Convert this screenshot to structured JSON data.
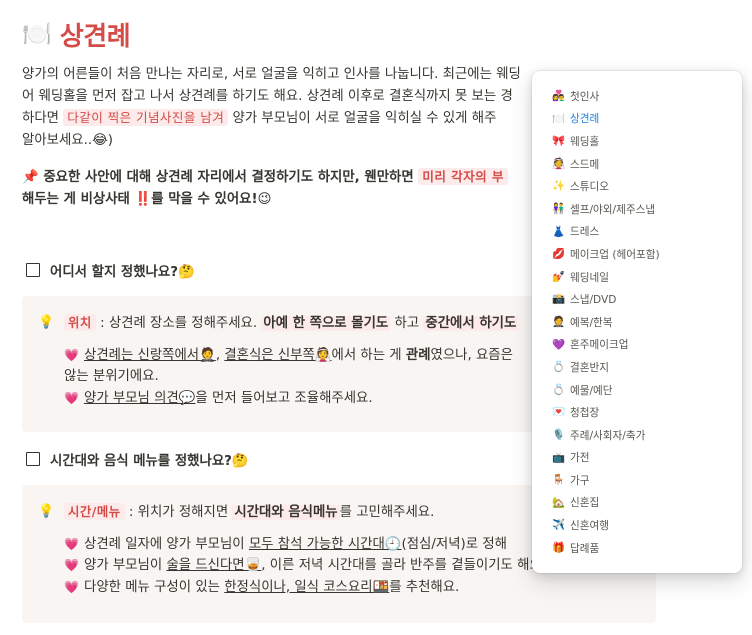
{
  "page": {
    "icon": "🍽️",
    "title": "상견례"
  },
  "intro": {
    "line1": "양가의 어른들이 처음 만나는 자리로, 서로 얼굴을 익히고 인사를 나눕니다. 최근에는 웨딩",
    "line2": "어 웨딩홀을 먼저 잡고 나서 상견례를 하기도 해요. 상견례 이후로 결혼식까지 못 보는 경",
    "line3_pre": "하다면 ",
    "line3_hl": "다같이 찍은 기념사진을 남겨",
    "line3_post": " 양가 부모님이 서로 얼굴을 익히실 수 있게 해주",
    "line4": "알아보세요..😂)"
  },
  "important": {
    "pin": "📌",
    "pre": "중요한 사안에 대해 상견례 자리에서 결정하기도 하지만, 웬만하면 ",
    "hl": "미리 각자의 부",
    "line2_pre": "해두는 게 비상사태 ",
    "bang": "‼️",
    "line2_post": "를 막을 수 있어요!😉"
  },
  "todo1": {
    "label": "어디서 할지 정했나요?🤔"
  },
  "callout1": {
    "tag": "위치",
    "pre": " : 상견례 장소를 정해주세요. ",
    "bold1": "아예 한 쪽으로 몰기도",
    "mid": " 하고 ",
    "bold2": "중간에서 하기도",
    "items": [
      {
        "a": "상견례는 신랑쪽에서🤵",
        "b": ", ",
        "c": "결혼식은 신부쪽👰",
        "d": "에서 하는 게 ",
        "e": "관례",
        "f": "였으나, 요즘은"
      },
      {
        "a": "않는 분위기에요."
      },
      {
        "a": "양가 부모님 의견💬",
        "b": "을 먼저 들어보고 조율해주세요."
      }
    ]
  },
  "todo2": {
    "label": "시간대와 음식 메뉴를 정했나요?🤔"
  },
  "callout2": {
    "tag": "시간/메뉴",
    "pre": " : 위치가 정해지면 ",
    "bold": "시간대와 음식메뉴",
    "post": "를 고민해주세요.",
    "items": [
      {
        "a": "상견례 일자에 양가 부모님이 ",
        "b": "모두 참석 가능한 시간대🕘",
        "c": "(점심/저녁)로 정해"
      },
      {
        "a": "양가 부모님이 ",
        "b": "술을 드신다면🥃",
        "c": ", 이른 저녁 시간대를 골라 반주를 곁들이기도 해요."
      },
      {
        "a": "다양한 메뉴 구성이 있는 ",
        "b": "한정식이나, 일식 코스요리🍱",
        "c": "를 추천해요."
      }
    ]
  },
  "menu": {
    "items": [
      {
        "icon": "👩‍❤️‍👨",
        "label": "첫인사",
        "active": false
      },
      {
        "icon": "🍽️",
        "label": "상견례",
        "active": true
      },
      {
        "icon": "🎀",
        "label": "웨딩홀",
        "active": false
      },
      {
        "icon": "👰",
        "label": "스드메",
        "active": false
      },
      {
        "icon": "✨",
        "label": "스튜디오",
        "active": false
      },
      {
        "icon": "👫",
        "label": "셀프/야외/제주스냅",
        "active": false
      },
      {
        "icon": "👗",
        "label": "드레스",
        "active": false
      },
      {
        "icon": "💋",
        "label": "메이크업 (헤어포함)",
        "active": false
      },
      {
        "icon": "💅",
        "label": "웨딩네일",
        "active": false
      },
      {
        "icon": "📸",
        "label": "스냅/DVD",
        "active": false
      },
      {
        "icon": "🤵",
        "label": "예복/한복",
        "active": false
      },
      {
        "icon": "💜",
        "label": "혼주메이크업",
        "active": false
      },
      {
        "icon": "💍",
        "label": "결혼반지",
        "active": false
      },
      {
        "icon": "💍",
        "label": "예물/예단",
        "active": false
      },
      {
        "icon": "💌",
        "label": "청첩장",
        "active": false
      },
      {
        "icon": "🎙️",
        "label": "주례/사회자/축가",
        "active": false
      },
      {
        "icon": "📺",
        "label": "가전",
        "active": false
      },
      {
        "icon": "🪑",
        "label": "가구",
        "active": false
      },
      {
        "icon": "🏡",
        "label": "신혼집",
        "active": false
      },
      {
        "icon": "✈️",
        "label": "신혼여행",
        "active": false
      },
      {
        "icon": "🎁",
        "label": "답례품",
        "active": false
      }
    ]
  }
}
